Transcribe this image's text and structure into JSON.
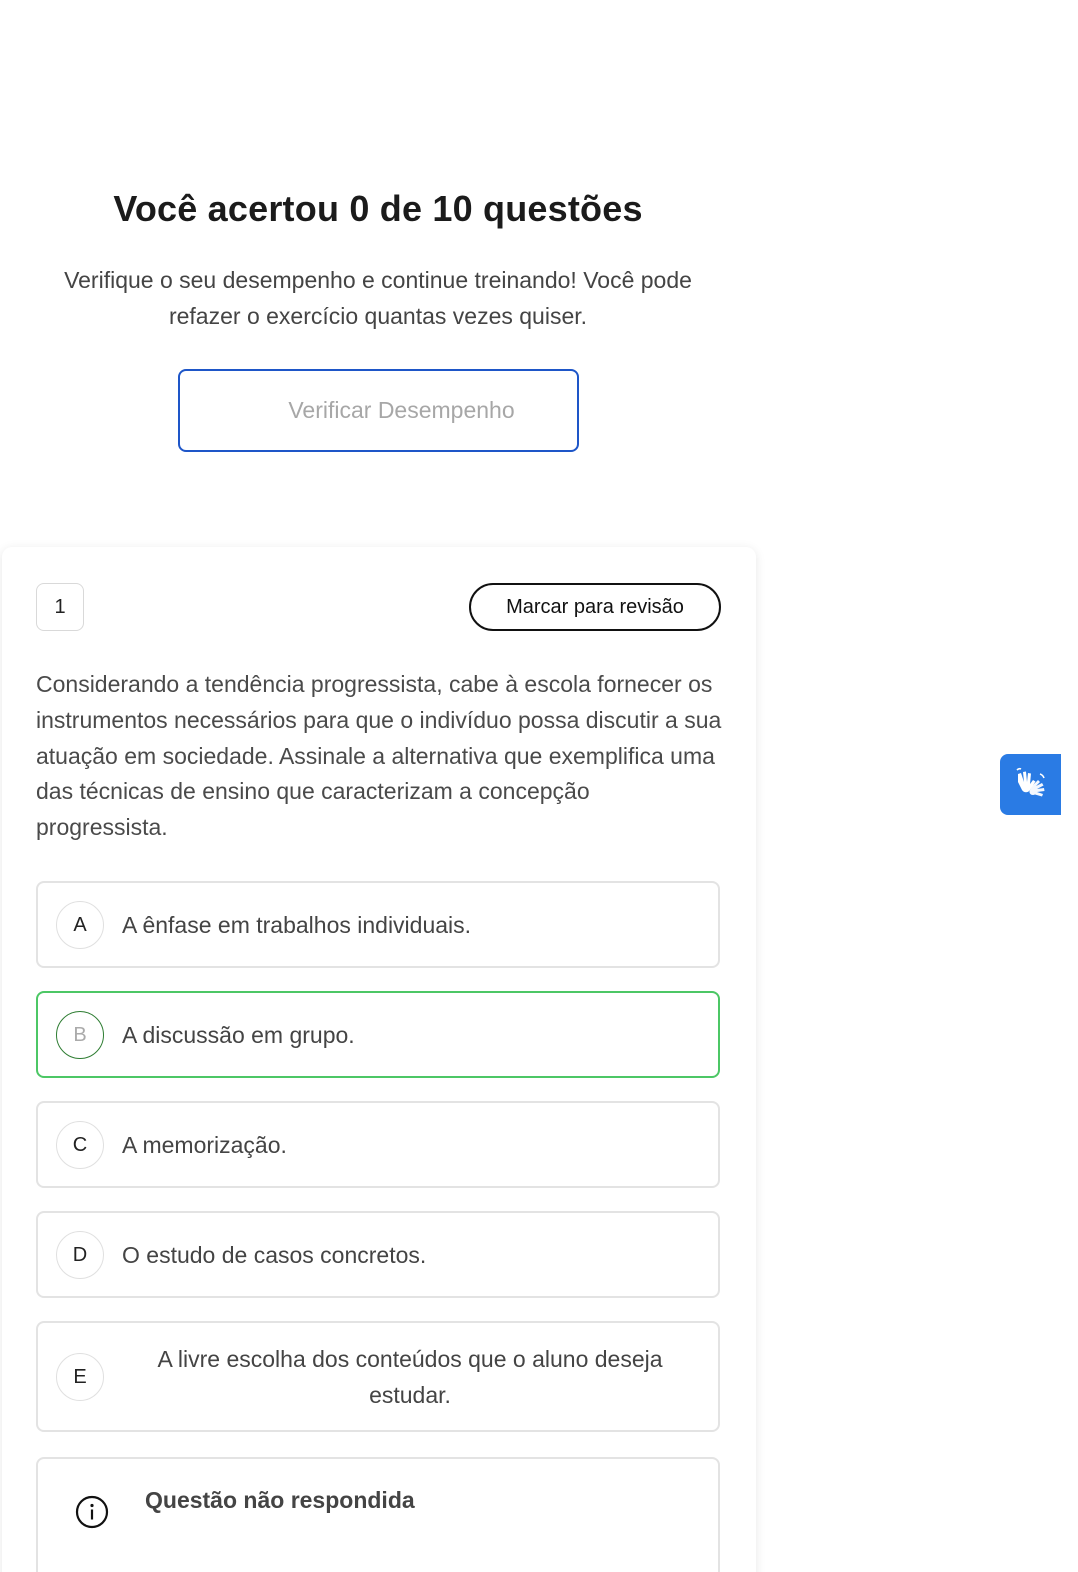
{
  "result": {
    "title": "Você acertou 0 de 10 questões",
    "subtitle": "Verifique o seu desempenho e continue treinando! Você pode refazer o exercício quantas vezes quiser.",
    "verify_button": "Verificar Desempenho"
  },
  "question": {
    "number": "1",
    "review_button": "Marcar para revisão",
    "text": "Considerando a tendência progressista, cabe à escola fornecer os instrumentos necessários para que o indivíduo possa discutir a sua atuação em sociedade. Assinale a alternativa que exemplifica uma das técnicas de ensino que caracterizam a concepção progressista.",
    "options": [
      {
        "letter": "A",
        "text": "A ênfase em trabalhos individuais."
      },
      {
        "letter": "B",
        "text": "A discussão em grupo.",
        "state": "correct"
      },
      {
        "letter": "C",
        "text": "A memorização."
      },
      {
        "letter": "D",
        "text": "O estudo de casos concretos."
      },
      {
        "letter": "E",
        "text": "A livre escolha dos conteúdos que o aluno deseja estudar."
      }
    ],
    "feedback": {
      "title": "Questão não respondida",
      "icon": "info-icon"
    }
  },
  "accessibility": {
    "icon": "sign-language-hands-icon",
    "color": "#2a7be4"
  },
  "colors": {
    "primary_border": "#1e56c8",
    "correct_border": "#4cc765"
  }
}
